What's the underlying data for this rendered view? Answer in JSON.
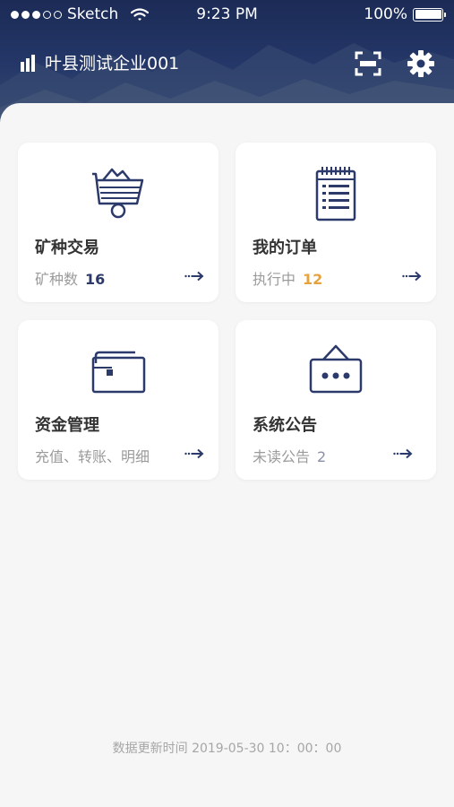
{
  "status_bar": {
    "carrier": "Sketch",
    "time": "9:23 PM",
    "battery": "100%"
  },
  "header": {
    "company_name": "叶县测试企业001",
    "scan_icon": "scan-icon",
    "settings_icon": "gear-icon"
  },
  "cards": [
    {
      "title": "矿种交易",
      "sub_label": "矿种数",
      "count": "16",
      "count_color": "#2b3a6b",
      "icon": "mine-cart-icon"
    },
    {
      "title": "我的订单",
      "sub_label": "执行中",
      "count": "12",
      "count_color": "#e6a23c",
      "icon": "notepad-icon"
    },
    {
      "title": "资金管理",
      "sub_label": "充值、转账、明细",
      "icon": "wallet-icon"
    },
    {
      "title": "系统公告",
      "sub_label": "未读公告",
      "count": "2",
      "count_color": "#8a8fa8",
      "icon": "notice-board-icon"
    }
  ],
  "footer": {
    "update_time": "数据更新时间 2019-05-30 10：00：00"
  },
  "colors": {
    "header_bg": "#1f2d5a",
    "accent": "#2b3a6b",
    "orange": "#e6a23c"
  }
}
